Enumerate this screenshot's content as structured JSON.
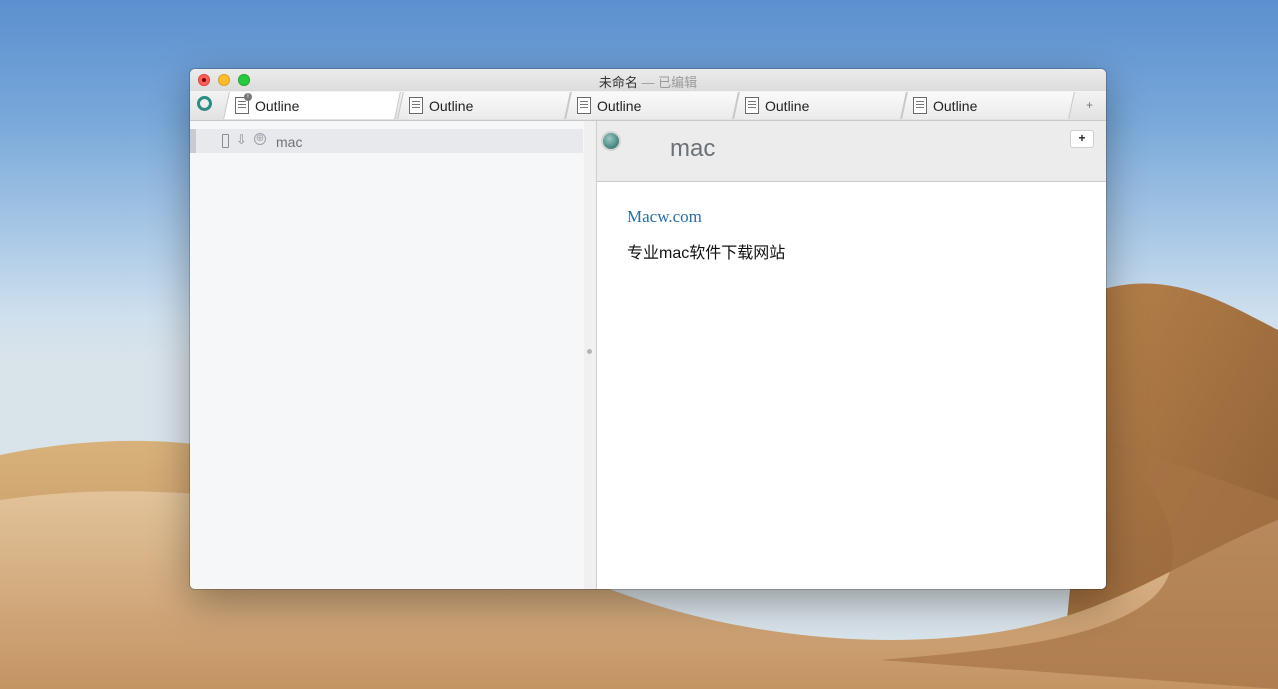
{
  "window": {
    "title": "未命名",
    "title_status": "— 已编辑"
  },
  "tabs": [
    {
      "label": "Outline",
      "active": true
    },
    {
      "label": "Outline",
      "active": false
    },
    {
      "label": "Outline",
      "active": false
    },
    {
      "label": "Outline",
      "active": false
    },
    {
      "label": "Outline",
      "active": false
    }
  ],
  "tab_add_label": "+",
  "sidebar": {
    "items": [
      {
        "label": "mac",
        "expander_symbol": "⇩",
        "add_symbol": "⊕"
      }
    ]
  },
  "content": {
    "title": "mac",
    "add_button_label": "+",
    "note_link": "Macw.com",
    "note_text": "专业mac软件下载网站"
  },
  "colors": {
    "accent": "#2e8a84",
    "link": "#2a6fa2"
  },
  "icons": {
    "app": "app-circle-icon",
    "tab": "outline-document-icon",
    "node": "node-dot-icon"
  }
}
